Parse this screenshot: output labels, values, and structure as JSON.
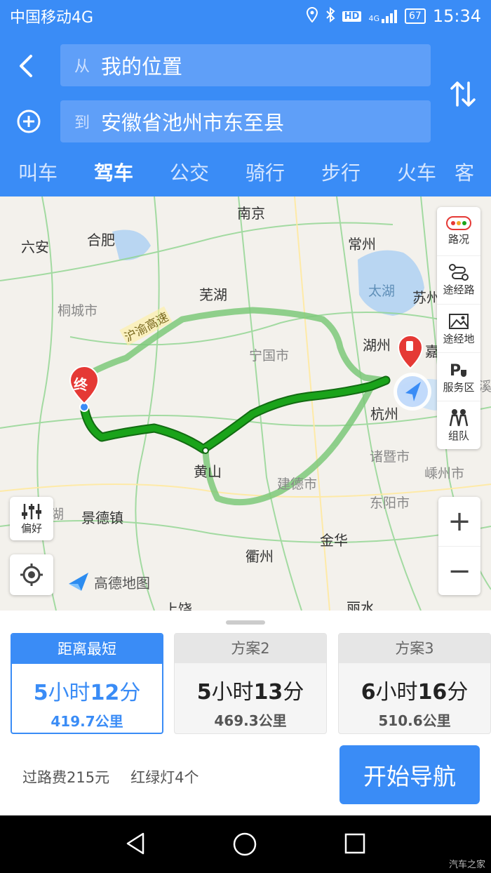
{
  "status_bar": {
    "carrier": "中国移动4G",
    "hd": "HD",
    "net": "4G",
    "battery": "67",
    "time": "15:34"
  },
  "route": {
    "from_prefix": "从",
    "from": "我的位置",
    "to_prefix": "到",
    "to": "安徽省池州市东至县"
  },
  "tabs": [
    "叫车",
    "驾车",
    "公交",
    "骑行",
    "步行",
    "火车",
    "客"
  ],
  "active_tab": "驾车",
  "map": {
    "cities": {
      "nanjing": "南京",
      "hefei": "合肥",
      "luan": "六安",
      "changzhou": "常州",
      "wuhu": "芜湖",
      "taihu": "太湖",
      "suzhou": "苏州",
      "tongcheng": "桐城市",
      "ningguo": "宁国市",
      "huzhou": "湖州",
      "jia": "嘉",
      "hangzhou": "杭州",
      "zhuji": "诸暨市",
      "shengzhou": "嵊州市",
      "huangshan": "黄山",
      "jiande": "建德市",
      "dongyang": "东阳市",
      "jingdezhen": "景德镇",
      "jinhua": "金华",
      "quzhou": "衢州",
      "shangrao": "上饶",
      "lishui": "丽水",
      "xi": "溪",
      "hu": "湖"
    },
    "highway_label": "沪渝高速",
    "end_marker": "终",
    "controls": {
      "traffic": "路况",
      "via_road": "途经路",
      "via_place": "途经地",
      "service": "服务区",
      "team": "组队",
      "preference": "偏好",
      "zoom_in": "+",
      "zoom_out": "−"
    },
    "logo": "高德地图"
  },
  "plans": [
    {
      "label": "距离最短",
      "hours": "5",
      "h_unit": "小时",
      "mins": "12",
      "m_unit": "分",
      "distance": "419.7公里",
      "selected": true
    },
    {
      "label": "方案2",
      "hours": "5",
      "h_unit": "小时",
      "mins": "13",
      "m_unit": "分",
      "distance": "469.3公里",
      "selected": false
    },
    {
      "label": "方案3",
      "hours": "6",
      "h_unit": "小时",
      "mins": "16",
      "m_unit": "分",
      "distance": "510.6公里",
      "selected": false
    }
  ],
  "summary": {
    "toll": "过路费215元",
    "lights": "红绿灯4个"
  },
  "start_button": "开始导航",
  "watermark": "汽车之家",
  "colors": {
    "primary": "#3a8cf6",
    "route_main": "#1aa31a",
    "route_alt": "#8fd38a"
  }
}
